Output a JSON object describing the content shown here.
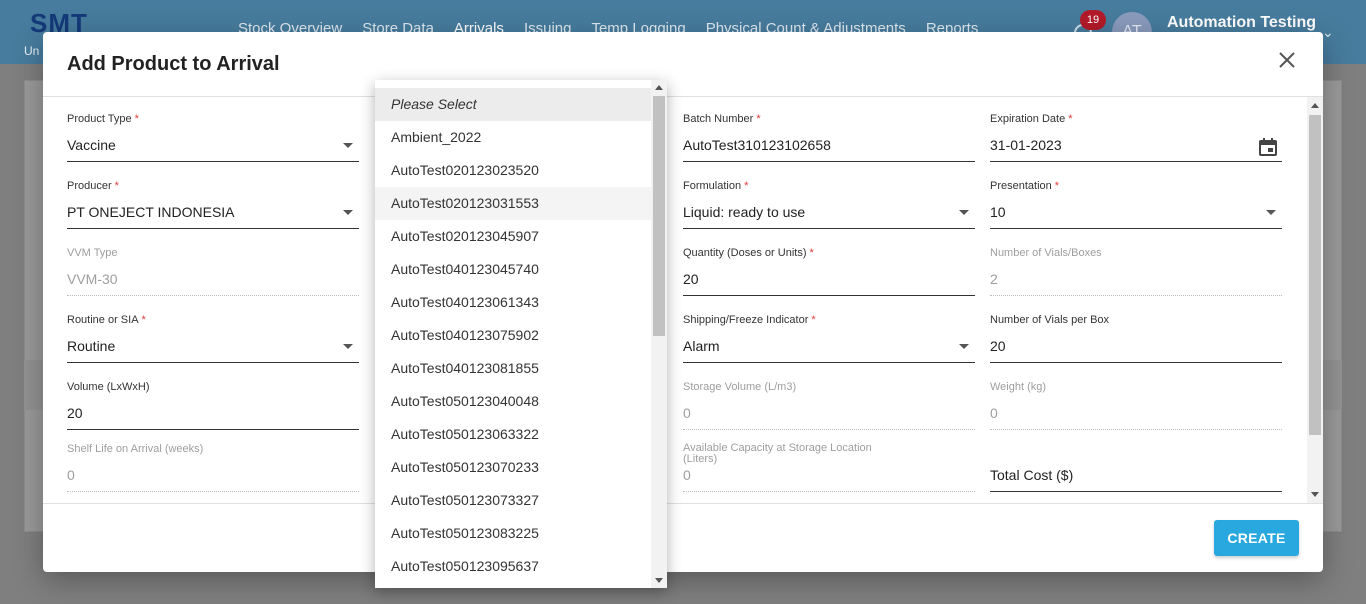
{
  "app": {
    "logo": "SMT",
    "logo_sub": "Un",
    "nav": [
      "Stock Overview",
      "Store Data",
      "Arrivals",
      "Issuing",
      "Temp Logging",
      "Physical Count & Adjustments",
      "Reports"
    ],
    "notification_count": "19",
    "avatar_initials": "AT",
    "user_name": "Automation Testing"
  },
  "modal": {
    "title": "Add Product to Arrival",
    "create_label": "CREATE"
  },
  "fields": {
    "product_type": {
      "label": "Product Type",
      "value": "Vaccine"
    },
    "producer": {
      "label": "Producer",
      "value": "PT ONEJECT INDONESIA"
    },
    "vvm_type": {
      "label": "VVM Type",
      "value": "VVM-30"
    },
    "routine_sia": {
      "label": "Routine or SIA",
      "value": "Routine"
    },
    "volume": {
      "label": "Volume (LxWxH)",
      "value": "20"
    },
    "shelf_life": {
      "label": "Shelf Life on Arrival (weeks)",
      "value": "0"
    },
    "batch_number": {
      "label": "Batch Number",
      "value": "AutoTest310123102658"
    },
    "formulation": {
      "label": "Formulation",
      "value": "Liquid: ready to use"
    },
    "quantity": {
      "label": "Quantity (Doses or Units)",
      "value": "20"
    },
    "shipping_indicator": {
      "label": "Shipping/Freeze Indicator",
      "value": "Alarm"
    },
    "storage_volume": {
      "label": "Storage Volume (L/m3)",
      "value": "0"
    },
    "available_capacity": {
      "label": "Available Capacity at Storage Location (Liters)",
      "value": "0"
    },
    "expiration_date": {
      "label": "Expiration Date",
      "value": "31-01-2023"
    },
    "presentation": {
      "label": "Presentation",
      "value": "10"
    },
    "num_vials": {
      "label": "Number of Vials/Boxes",
      "value": "2"
    },
    "vials_per_box": {
      "label": "Number of Vials per Box",
      "value": "20"
    },
    "weight": {
      "label": "Weight (kg)",
      "value": "0"
    },
    "total_cost": {
      "label": "",
      "value": "Total Cost ($)"
    }
  },
  "dropdown": {
    "items": [
      "Please Select",
      "Ambient_2022",
      "AutoTest020123023520",
      "AutoTest020123031553",
      "AutoTest020123045907",
      "AutoTest040123045740",
      "AutoTest040123061343",
      "AutoTest040123075902",
      "AutoTest040123081855",
      "AutoTest050123040048",
      "AutoTest050123063322",
      "AutoTest050123070233",
      "AutoTest050123073327",
      "AutoTest050123083225",
      "AutoTest050123095637"
    ]
  },
  "colors": {
    "accent": "#29a8e0",
    "required": "#e53935",
    "header": "#1a7ab8"
  }
}
